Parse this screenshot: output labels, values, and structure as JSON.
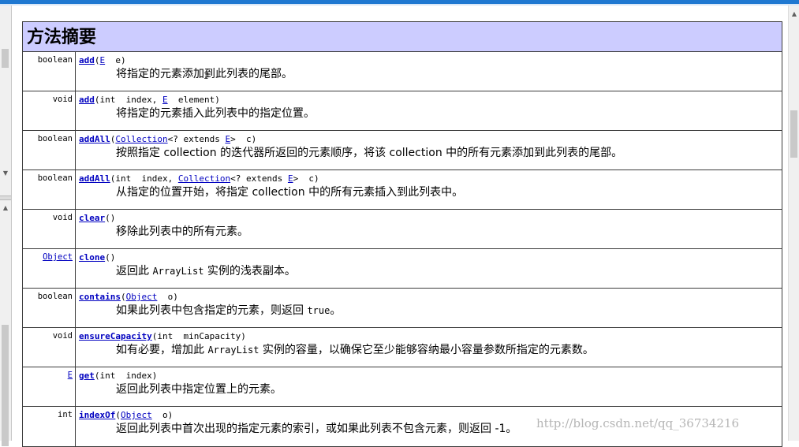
{
  "header": {
    "title": "方法摘要"
  },
  "rows": [
    {
      "type": "boolean",
      "sig": [
        [
          "m",
          "add"
        ],
        [
          "p",
          "("
        ],
        [
          "l",
          "E"
        ],
        [
          "p",
          "  e)"
        ]
      ],
      "desc": [
        [
          "t",
          "将指定的元素添加到此列表的尾部。"
        ]
      ]
    },
    {
      "type": "void",
      "sig": [
        [
          "m",
          "add"
        ],
        [
          "p",
          "(int  index, "
        ],
        [
          "l",
          "E"
        ],
        [
          "p",
          "  element)"
        ]
      ],
      "desc": [
        [
          "t",
          "将指定的元素插入此列表中的指定位置。"
        ]
      ]
    },
    {
      "type": "boolean",
      "sig": [
        [
          "m",
          "addAll"
        ],
        [
          "p",
          "("
        ],
        [
          "l",
          "Collection"
        ],
        [
          "p",
          "<? extends "
        ],
        [
          "l",
          "E"
        ],
        [
          "p",
          ">  c)"
        ]
      ],
      "desc": [
        [
          "t",
          "按照指定 collection 的迭代器所返回的元素顺序，将该 collection 中的所有元素添加到此列表的尾部。"
        ]
      ]
    },
    {
      "type": "boolean",
      "sig": [
        [
          "m",
          "addAll"
        ],
        [
          "p",
          "(int  index, "
        ],
        [
          "l",
          "Collection"
        ],
        [
          "p",
          "<? extends "
        ],
        [
          "l",
          "E"
        ],
        [
          "p",
          ">  c)"
        ]
      ],
      "desc": [
        [
          "t",
          "从指定的位置开始，将指定 collection 中的所有元素插入到此列表中。"
        ]
      ]
    },
    {
      "type": "void",
      "sig": [
        [
          "m",
          "clear"
        ],
        [
          "p",
          "()"
        ]
      ],
      "desc": [
        [
          "t",
          "移除此列表中的所有元素。"
        ]
      ]
    },
    {
      "type": "Object",
      "typeLink": true,
      "sig": [
        [
          "m",
          "clone"
        ],
        [
          "p",
          "()"
        ]
      ],
      "desc": [
        [
          "t",
          "返回此 "
        ],
        [
          "c",
          "ArrayList"
        ],
        [
          "t",
          " 实例的浅表副本。"
        ]
      ]
    },
    {
      "type": "boolean",
      "sig": [
        [
          "m",
          "contains"
        ],
        [
          "p",
          "("
        ],
        [
          "l",
          "Object"
        ],
        [
          "p",
          "  o)"
        ]
      ],
      "desc": [
        [
          "t",
          "如果此列表中包含指定的元素，则返回 "
        ],
        [
          "c",
          "true"
        ],
        [
          "t",
          "。"
        ]
      ]
    },
    {
      "type": "void",
      "sig": [
        [
          "m",
          "ensureCapacity"
        ],
        [
          "p",
          "(int  minCapacity)"
        ]
      ],
      "desc": [
        [
          "t",
          "如有必要，增加此 "
        ],
        [
          "c",
          "ArrayList"
        ],
        [
          "t",
          " 实例的容量，以确保它至少能够容纳最小容量参数所指定的元素数。"
        ]
      ]
    },
    {
      "type": "E",
      "typeLink": true,
      "sig": [
        [
          "m",
          "get"
        ],
        [
          "p",
          "(int  index)"
        ]
      ],
      "desc": [
        [
          "t",
          "返回此列表中指定位置上的元素。"
        ]
      ]
    },
    {
      "type": "int",
      "sig": [
        [
          "m",
          "indexOf"
        ],
        [
          "p",
          "("
        ],
        [
          "l",
          "Object"
        ],
        [
          "p",
          "  o)"
        ]
      ],
      "desc": [
        [
          "t",
          "返回此列表中首次出现的指定元素的索引，或如果此列表不包含元素，则返回 -1。"
        ]
      ]
    }
  ],
  "watermark": "http://blog.csdn.net/qq_36734216"
}
